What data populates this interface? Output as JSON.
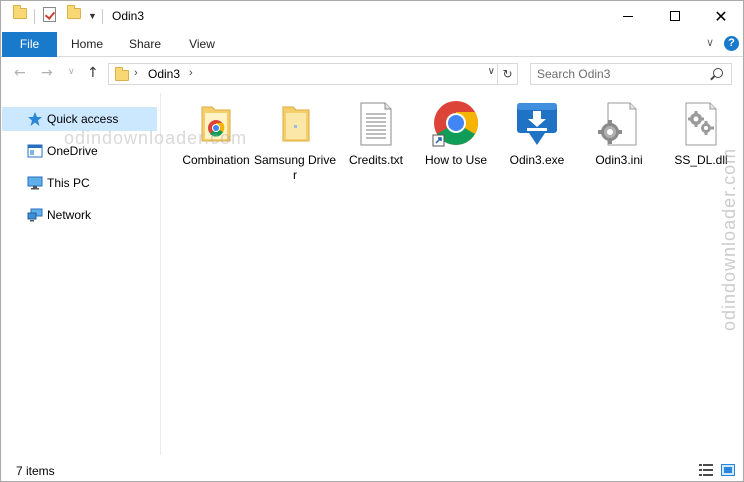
{
  "window": {
    "title": "Odin3"
  },
  "titlebar": {
    "minimize_icon": "minimize-icon",
    "maximize_icon": "maximize-icon",
    "close_icon": "close-icon"
  },
  "ribbon": {
    "tabs": [
      {
        "label": "File"
      },
      {
        "label": "Home"
      },
      {
        "label": "Share"
      },
      {
        "label": "View"
      }
    ],
    "accent": "#1979ca"
  },
  "address": {
    "crumbs": [
      "Odin3"
    ],
    "search_placeholder": "Search Odin3"
  },
  "sidebar": {
    "items": [
      {
        "label": "Quick access",
        "icon": "star-icon",
        "selected": true
      },
      {
        "label": "OneDrive",
        "icon": "onedrive-icon"
      },
      {
        "label": "This PC",
        "icon": "computer-icon"
      },
      {
        "label": "Network",
        "icon": "network-icon"
      }
    ],
    "selected_color": "#cce8ff"
  },
  "files": [
    {
      "label": "Combination",
      "icon": "chrome-folder-icon"
    },
    {
      "label": "Samsung Driver",
      "icon": "folder-icon"
    },
    {
      "label": "Credits.txt",
      "icon": "text-file-icon"
    },
    {
      "label": "How to Use",
      "icon": "chrome-shortcut-icon"
    },
    {
      "label": "Odin3.exe",
      "icon": "odin-app-icon"
    },
    {
      "label": "Odin3.ini",
      "icon": "config-file-icon"
    },
    {
      "label": "SS_DL.dll",
      "icon": "dll-file-icon"
    }
  ],
  "watermark": {
    "text": "odindownloader.com"
  },
  "status": {
    "item_count": "7 items"
  }
}
